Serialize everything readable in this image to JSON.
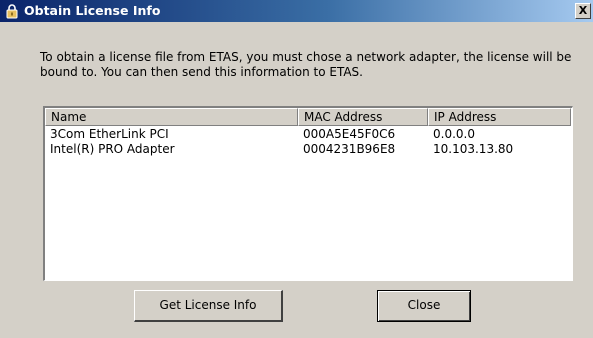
{
  "window": {
    "title": "Obtain License Info",
    "close_label": "X",
    "title_icon": "lock-icon"
  },
  "description": "To obtain a license file from ETAS, you must chose a network adapter, the license will be bound to. You can then send this information to ETAS.",
  "adapters": {
    "columns": [
      "Name",
      "MAC Address",
      "IP Address"
    ],
    "rows": [
      {
        "name": "3Com EtherLink PCI",
        "mac": "000A5E45F0C6",
        "ip": "0.0.0.0"
      },
      {
        "name": "Intel(R) PRO Adapter",
        "mac": "0004231B96E8",
        "ip": "10.103.13.80"
      }
    ]
  },
  "buttons": {
    "get_license": "Get License Info",
    "close": "Close"
  },
  "colors": {
    "titlebar_start": "#0a246a",
    "titlebar_end": "#a6caf0",
    "dialog_bg": "#d4d0c8"
  }
}
